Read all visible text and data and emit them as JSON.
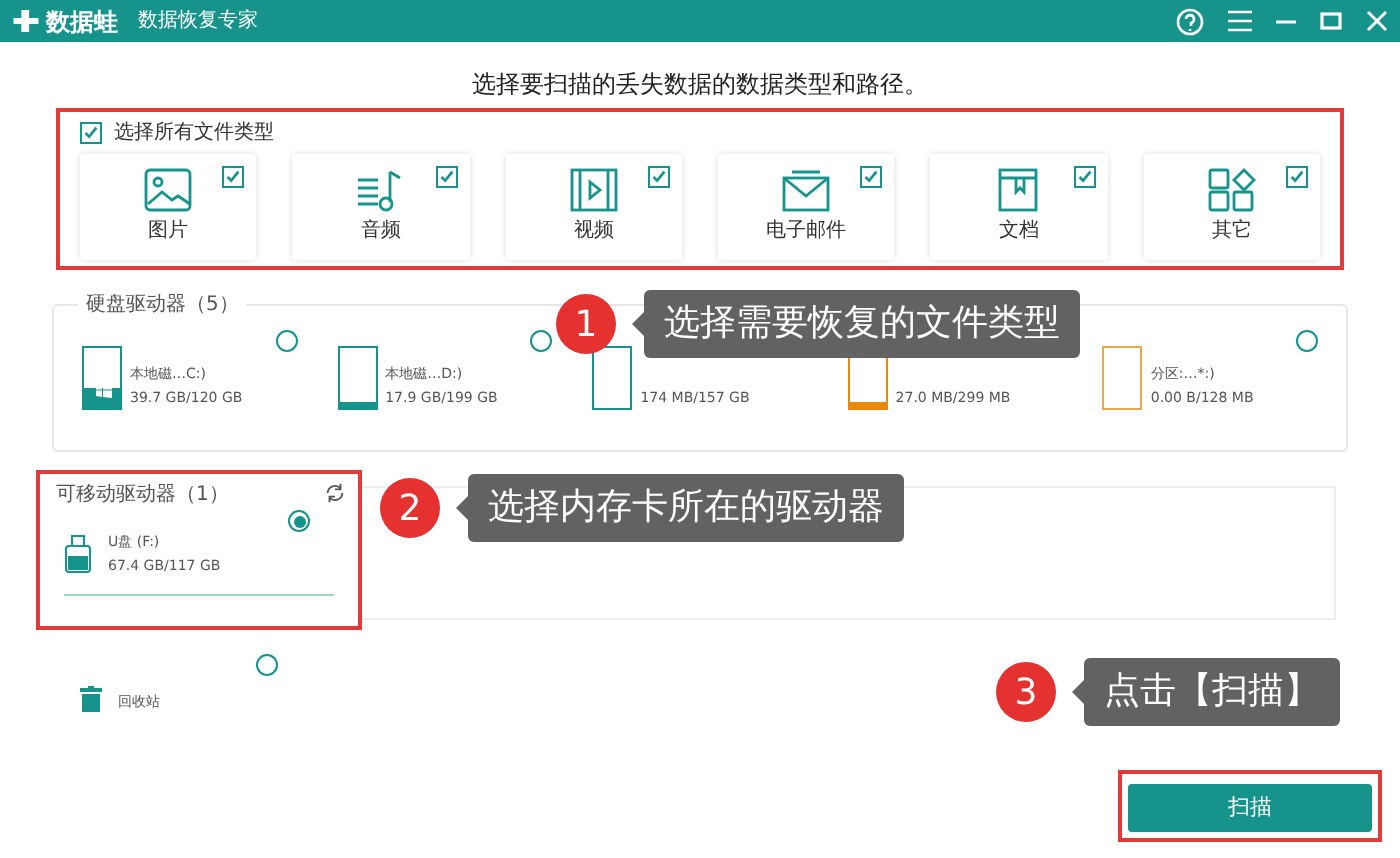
{
  "window": {
    "app_name": "数据蛙",
    "subtitle": "数据恢复专家"
  },
  "instruction": "选择要扫描的丢失数据的数据类型和路径。",
  "file_types": {
    "select_all": {
      "label": "选择所有文件类型",
      "checked": true
    },
    "items": [
      {
        "kind": "image",
        "label": "图片",
        "checked": true
      },
      {
        "kind": "audio",
        "label": "音频",
        "checked": true
      },
      {
        "kind": "video",
        "label": "视频",
        "checked": true
      },
      {
        "kind": "email",
        "label": "电子邮件",
        "checked": true
      },
      {
        "kind": "document",
        "label": "文档",
        "checked": true
      },
      {
        "kind": "other",
        "label": "其它",
        "checked": true
      }
    ]
  },
  "hard_drives": {
    "title": "硬盘驱动器（5）",
    "drives": [
      {
        "name": "本地磁…C:)",
        "size": "39.7 GB/120 GB",
        "level": 0.35,
        "color": "#16938b",
        "system": true,
        "selected": false
      },
      {
        "name": "本地磁…D:)",
        "size": "17.9 GB/199 GB",
        "level": 0.1,
        "color": "#16938b",
        "system": false,
        "selected": false
      },
      {
        "size": "174 MB/157 GB",
        "level": 0,
        "color": "#16938b",
        "system": false
      },
      {
        "size": "27.0 MB/299 MB",
        "level": 0.1,
        "color": "#e8890c",
        "system": false
      },
      {
        "name": "分区:…*:)",
        "size": "0.00  B/128 MB",
        "level": 0,
        "color": "#e8a94a",
        "system": false,
        "selected": false
      }
    ]
  },
  "removable_drives": {
    "title": "可移动驱动器（1）",
    "drives": [
      {
        "name": "U盘 (F:)",
        "size": "67.4 GB/117 GB",
        "selected": true
      }
    ]
  },
  "recycle_bin": {
    "label": "回收站",
    "selected": false
  },
  "scan_button": "扫描",
  "callouts": [
    {
      "number": "1",
      "text": "选择需要恢复的文件类型"
    },
    {
      "number": "2",
      "text": "选择内存卡所在的驱动器"
    },
    {
      "number": "3",
      "text": "点击【扫描】"
    }
  ]
}
